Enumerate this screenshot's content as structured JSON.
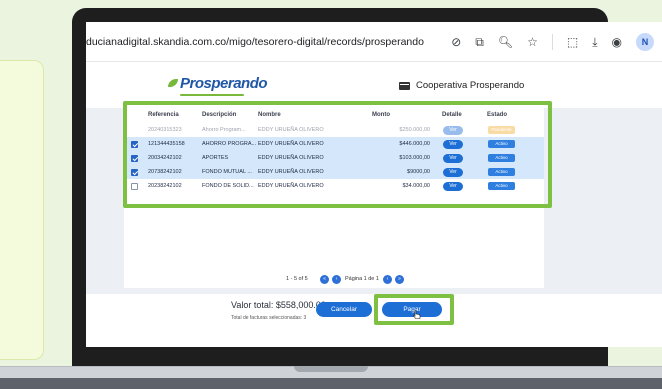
{
  "browser": {
    "url": "ducianadigital.skandia.com.co/migo/tesorero-digital/records/prosperando",
    "avatar_initial": "N"
  },
  "app": {
    "logo": "Prosperando",
    "cooperative_label": "Cooperativa Prosperando"
  },
  "table": {
    "columns": [
      "Referencia",
      "Descripción",
      "Nombre",
      "Monto",
      "Detalle",
      "Estado"
    ],
    "rows": [
      {
        "checked": false,
        "ref": "20240315323",
        "desc": "Ahorro Program...",
        "name": "EDDY URUEÑA OLIVERO",
        "amount": "$250.000,00",
        "detail": "Ver",
        "status": "Pendiente",
        "faded": true
      },
      {
        "checked": true,
        "ref": "121344435158",
        "desc": "AHORRO PROGRA...",
        "name": "EDDY URUEÑA OLIVERO",
        "amount": "$446.000,00",
        "detail": "Ver",
        "status": "Activo"
      },
      {
        "checked": true,
        "ref": "20034242102",
        "desc": "APORTES",
        "name": "EDDY URUEÑA OLIVERO",
        "amount": "$103.000,00",
        "detail": "Ver",
        "status": "Activo"
      },
      {
        "checked": true,
        "ref": "20738242102",
        "desc": "FONDO MUTUAL ...",
        "name": "EDDY URUEÑA OLIVERO",
        "amount": "$9000,00",
        "detail": "Ver",
        "status": "Activo"
      },
      {
        "checked": false,
        "ref": "20238242102",
        "desc": "FONDO DE SOLID...",
        "name": "EDDY URUEÑA OLIVERO",
        "amount": "$34.000,00",
        "detail": "Ver",
        "status": "Activo"
      }
    ]
  },
  "pagination": {
    "range": "1 - 5 of 5",
    "page": "Página 1 de 1"
  },
  "footer": {
    "total": "Valor total: $558,000.00",
    "total_sub": "Total de facturas seleccionadas: 3",
    "cancel_label": "Cancelar",
    "pay_label": "Pagar"
  },
  "colors": {
    "highlight": "#7ec142",
    "primary": "#1d6fd6",
    "pending": "#f3b13a"
  }
}
